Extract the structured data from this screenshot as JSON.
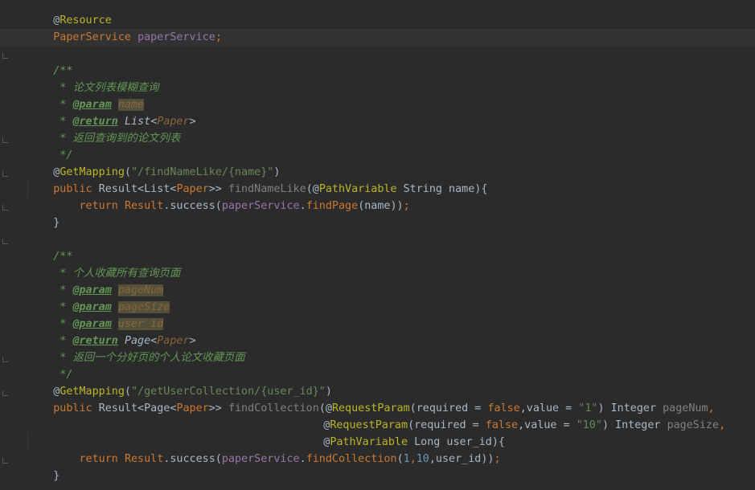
{
  "editor": {
    "language": "Java",
    "lines": {
      "l1": {
        "at": "@",
        "resource": "Resource"
      },
      "l2": {
        "type": "PaperService",
        "space": " ",
        "name": "paperService",
        "semi": ";"
      },
      "l4": {
        "open": "/**"
      },
      "l5": {
        "star": " * ",
        "desc": "论文列表模糊查询"
      },
      "l6": {
        "star": " * ",
        "tag": "@param",
        "space": " ",
        "param": "name"
      },
      "l7": {
        "star": " * ",
        "tag": "@return",
        "space": " ",
        "ret_type": "List",
        "lt": "<",
        "ret_generic": "Paper",
        "gt": ">"
      },
      "l8": {
        "star": " * ",
        "desc": "返回查询到的论文列表"
      },
      "l9": {
        "close": " */"
      },
      "l10": {
        "at": "@",
        "annotation": "GetMapping",
        "paren_open": "(",
        "path": "\"/findNameLike/{name}\"",
        "paren_close": ")"
      },
      "l11": {
        "kw_public": "public",
        "sp1": " ",
        "ret1": "Result<List<",
        "generic": "Paper",
        "ret2": ">> ",
        "method": "findNameLike",
        "args1": "(",
        "at": "@",
        "pv": "PathVariable",
        "args2": " String name){"
      },
      "l12": {
        "indent": "    ",
        "kw_return": "return",
        "sp": " ",
        "cls": "Result",
        "dot1": ".success(",
        "field": "paperService",
        "dot2": ".",
        "method": "findPage",
        "args": "(name))",
        "semi": ";"
      },
      "l13": {
        "brace": "}"
      },
      "l15": {
        "open": "/**"
      },
      "l16": {
        "star": " * ",
        "desc": "个人收藏所有查询页面"
      },
      "l17": {
        "star": " * ",
        "tag": "@param",
        "space": " ",
        "param": "pageNum"
      },
      "l18": {
        "star": " * ",
        "tag": "@param",
        "space": " ",
        "param": "pageSize"
      },
      "l19": {
        "star": " * ",
        "tag": "@param",
        "space": " ",
        "param": "user_id"
      },
      "l20": {
        "star": " * ",
        "tag": "@return",
        "space": " ",
        "ret_type": "Page",
        "lt": "<",
        "ret_generic": "Paper",
        "gt": ">"
      },
      "l21": {
        "star": " * ",
        "desc": "返回一个分好页的个人论文收藏页面"
      },
      "l22": {
        "close": " */"
      },
      "l23": {
        "at": "@",
        "annotation": "GetMapping",
        "paren_open": "(",
        "path": "\"/getUserCollection/{user_id}\"",
        "paren_close": ")"
      },
      "l24": {
        "kw_public": "public",
        "sp1": " ",
        "ret1": "Result<Page<",
        "generic": "Paper",
        "ret2": ">> ",
        "method": "findCollection",
        "paren": "(",
        "at": "@",
        "rp": "RequestParam",
        "args1": "(required = ",
        "kw_false": "false",
        "args2": ",value = ",
        "val": "\"1\"",
        "args3": ") Integer ",
        "param": "pageNum",
        "comma": ","
      },
      "l25": {
        "at": "@",
        "rp": "RequestParam",
        "args1": "(required = ",
        "kw_false": "false",
        "args2": ",value = ",
        "val": "\"10\"",
        "args3": ") Integer ",
        "param": "pageSize",
        "comma": ","
      },
      "l26": {
        "at": "@",
        "pv": "PathVariable",
        "args": " Long user_id){"
      },
      "l27": {
        "indent": "    ",
        "kw_return": "return",
        "sp": " ",
        "cls": "Result",
        "dot1": ".success(",
        "field": "paperService",
        "dot2": ".",
        "method": "findCollection",
        "p1": "(",
        "n1": "1",
        "c1": ",",
        "n2": "10",
        "rest": ",user_id))",
        "semi": ";"
      },
      "l28": {
        "brace": "}"
      },
      "l30": {
        "open": "/**"
      }
    }
  }
}
